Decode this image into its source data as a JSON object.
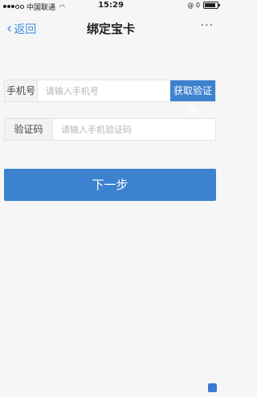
{
  "status_bar": {
    "carrier": "中国联通",
    "wifi_icon": "wifi-icon",
    "time": "15:29",
    "indicators": "@ 0",
    "battery_level": 0.85
  },
  "nav": {
    "back_label": "返回",
    "title": "绑定宝卡",
    "more_label": "···"
  },
  "form": {
    "phone_label": "手机号",
    "phone_placeholder": "请输入手机号",
    "get_code_label": "获取验证码",
    "code_label": "验证码",
    "code_placeholder": "请输入手机验证码"
  },
  "next_button": "下一步",
  "colors": {
    "accent": "#3d82cf",
    "link": "#3a8ee6",
    "background": "#f6f6f6"
  }
}
